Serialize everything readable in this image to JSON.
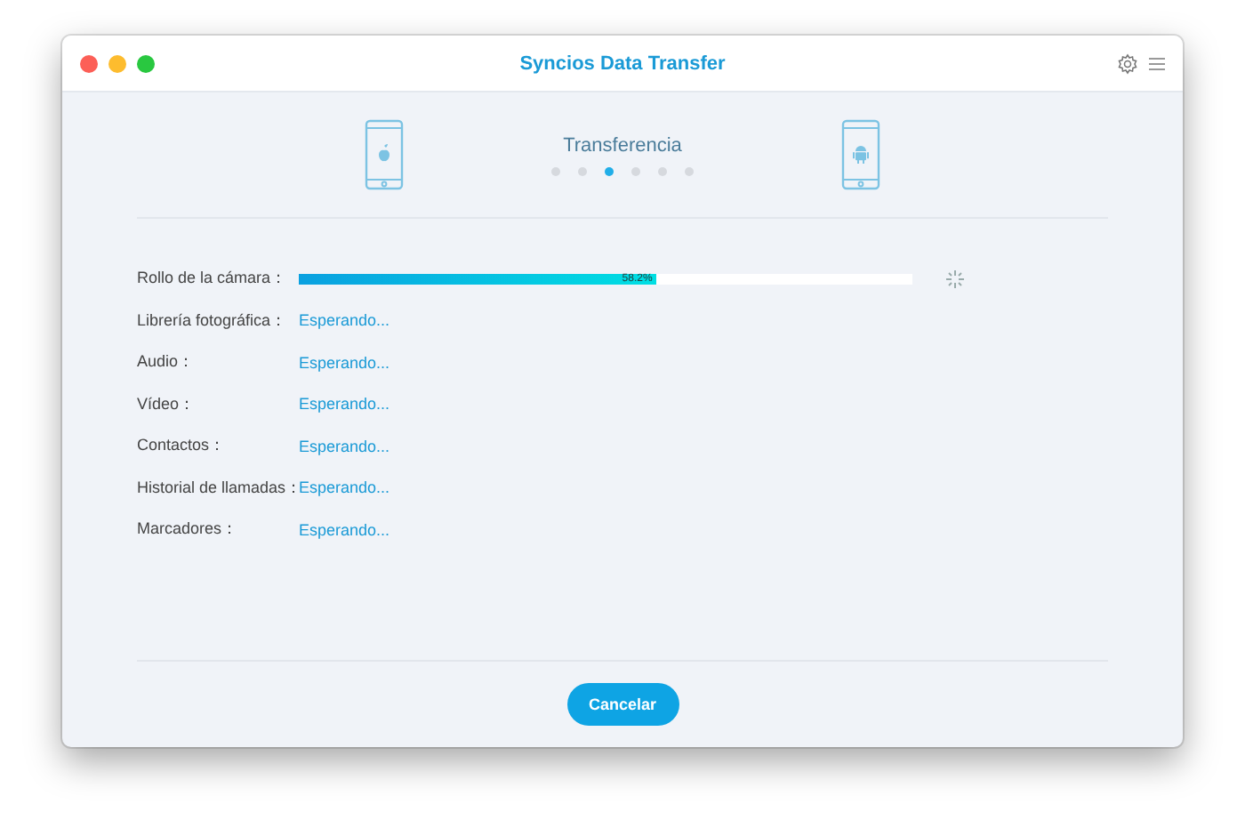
{
  "window": {
    "title": "Syncios Data Transfer"
  },
  "header": {
    "step_title": "Transferencia",
    "steps": [
      {
        "selected": false
      },
      {
        "selected": false
      },
      {
        "selected": true
      },
      {
        "selected": false
      },
      {
        "selected": false
      },
      {
        "selected": false
      }
    ]
  },
  "items": [
    {
      "kind": "progress",
      "label": "Rollo de la cámara：",
      "level": 0.582,
      "reading": "58.2%"
    },
    {
      "kind": "waiting",
      "label": "Librería fotográfica：",
      "status": "Esperando..."
    },
    {
      "kind": "waiting",
      "label": "Audio：",
      "status": "Esperando..."
    },
    {
      "kind": "waiting",
      "label": "Vídeo：",
      "status": "Esperando..."
    },
    {
      "kind": "waiting",
      "label": "Contactos：",
      "status": "Esperando..."
    },
    {
      "kind": "waiting",
      "label": "Historial de llamadas：",
      "status": "Esperando..."
    },
    {
      "kind": "waiting",
      "label": "Marcadores：",
      "status": "Esperando..."
    }
  ],
  "buttons": [
    "Cancelar"
  ]
}
